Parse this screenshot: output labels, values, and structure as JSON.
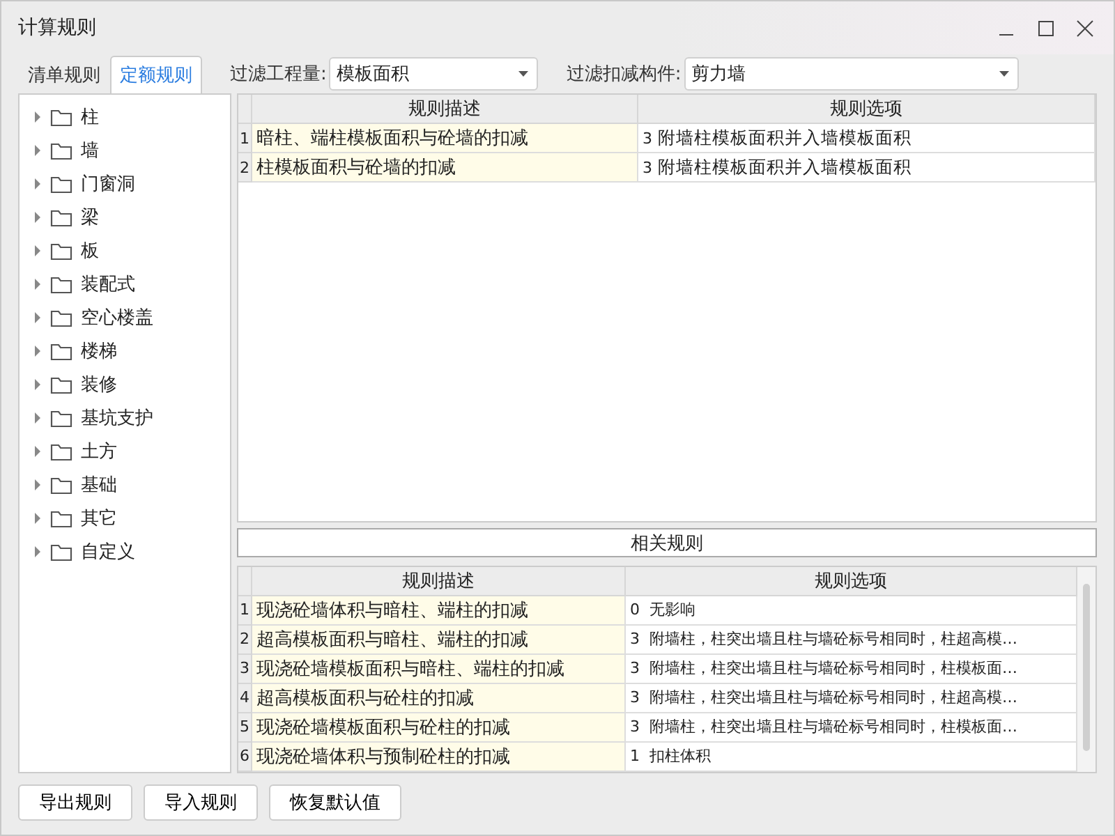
{
  "window": {
    "title": "计算规则"
  },
  "tabs": [
    {
      "label": "清单规则",
      "selected": false
    },
    {
      "label": "定额规则",
      "selected": true
    }
  ],
  "filters": [
    {
      "label": "过滤工程量:",
      "value": "模板面积"
    },
    {
      "label": "过滤扣减构件:",
      "value": "剪力墙"
    }
  ],
  "tree": [
    {
      "label": "柱"
    },
    {
      "label": "墙"
    },
    {
      "label": "门窗洞"
    },
    {
      "label": "梁"
    },
    {
      "label": "板"
    },
    {
      "label": "装配式"
    },
    {
      "label": "空心楼盖"
    },
    {
      "label": "楼梯"
    },
    {
      "label": "装修"
    },
    {
      "label": "基坑支护"
    },
    {
      "label": "土方"
    },
    {
      "label": "基础"
    },
    {
      "label": "其它"
    },
    {
      "label": "自定义"
    }
  ],
  "rules_table": {
    "columns": [
      "规则描述",
      "规则选项"
    ],
    "rows": [
      {
        "index": "1",
        "description": "暗柱、端柱模板面积与砼墙的扣减",
        "code": "3",
        "option": "附墙柱模板面积并入墙模板面积"
      },
      {
        "index": "2",
        "description": "柱模板面积与砼墙的扣减",
        "code": "3",
        "option": "附墙柱模板面积并入墙模板面积"
      }
    ]
  },
  "related_header": "相关规则",
  "related_table": {
    "columns": [
      "规则描述",
      "规则选项"
    ],
    "rows": [
      {
        "index": "1",
        "description": "现浇砼墙体积与暗柱、端柱的扣减",
        "code": "0",
        "option": "无影响"
      },
      {
        "index": "2",
        "description": "超高模板面积与暗柱、端柱的扣减",
        "code": "3",
        "option": "附墙柱，柱突出墙且柱与墙砼标号相同时，柱超高模…"
      },
      {
        "index": "3",
        "description": "现浇砼墙模板面积与暗柱、端柱的扣减",
        "code": "3",
        "option": "附墙柱，柱突出墙且柱与墙砼标号相同时，柱模板面…"
      },
      {
        "index": "4",
        "description": "超高模板面积与砼柱的扣减",
        "code": "3",
        "option": "附墙柱，柱突出墙且柱与墙砼标号相同时，柱超高模…"
      },
      {
        "index": "5",
        "description": "现浇砼墙模板面积与砼柱的扣减",
        "code": "3",
        "option": "附墙柱，柱突出墙且柱与墙砼标号相同时，柱模板面…"
      },
      {
        "index": "6",
        "description": "现浇砼墙体积与预制砼柱的扣减",
        "code": "1",
        "option": "扣柱体积"
      }
    ]
  },
  "buttons": [
    "导出规则",
    "导入规则",
    "恢复默认值"
  ]
}
